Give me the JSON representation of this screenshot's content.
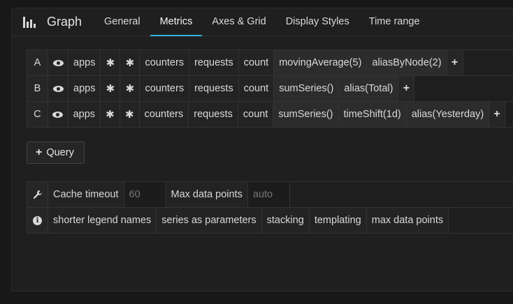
{
  "panel": {
    "title": "Graph",
    "icon": "bar-chart-icon"
  },
  "tabs": [
    {
      "label": "General",
      "active": false
    },
    {
      "label": "Metrics",
      "active": true
    },
    {
      "label": "Axes & Grid",
      "active": false
    },
    {
      "label": "Display Styles",
      "active": false
    },
    {
      "label": "Time range",
      "active": false
    }
  ],
  "colors": {
    "accent": "#33b5e5",
    "background": "#181818",
    "panel": "#1f1f1f"
  },
  "queries": [
    {
      "ref": "A",
      "segments": [
        "apps",
        "✱",
        "✱",
        "counters",
        "requests",
        "count"
      ],
      "functions": [
        "movingAverage(5)",
        "aliasByNode(2)"
      ],
      "add": "+"
    },
    {
      "ref": "B",
      "segments": [
        "apps",
        "✱",
        "✱",
        "counters",
        "requests",
        "count"
      ],
      "functions": [
        "sumSeries()",
        "alias(Total)"
      ],
      "add": "+"
    },
    {
      "ref": "C",
      "segments": [
        "apps",
        "✱",
        "✱",
        "counters",
        "requests",
        "count"
      ],
      "functions": [
        "sumSeries()",
        "timeShift(1d)",
        "alias(Yesterday)"
      ],
      "add": "+"
    }
  ],
  "query_button": {
    "label": "Query",
    "icon": "plus-icon"
  },
  "options": {
    "cache_timeout_label": "Cache timeout",
    "cache_timeout_placeholder": "60",
    "max_data_points_label": "Max data points",
    "max_data_points_placeholder": "auto",
    "wrench_icon": "wrench-icon"
  },
  "help": {
    "info_icon": "info-icon",
    "items": [
      "shorter legend names",
      "series as parameters",
      "stacking",
      "templating",
      "max data points"
    ]
  }
}
